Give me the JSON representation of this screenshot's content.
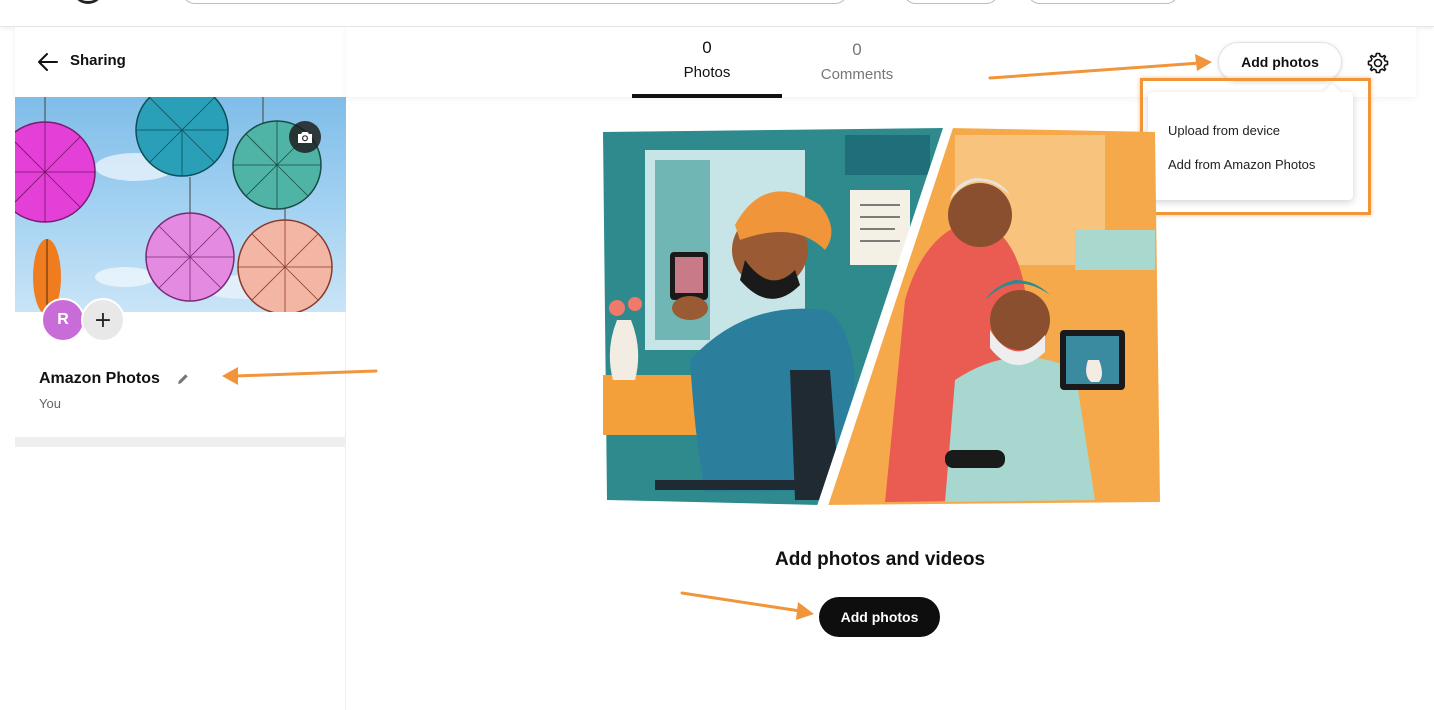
{
  "header": {
    "back_icon": "arrow-left-icon",
    "title": "Sharing"
  },
  "album": {
    "cover_icon": "camera-icon",
    "avatar_initial": "R",
    "avatar_color": "#c86dd7",
    "add_member_symbol": "+",
    "name": "Amazon Photos",
    "edit_icon": "pencil-icon",
    "owner": "You"
  },
  "tabs": [
    {
      "count": "0",
      "label": "Photos",
      "active": true
    },
    {
      "count": "0",
      "label": "Comments",
      "active": false
    }
  ],
  "toolbar": {
    "add_photos_label": "Add photos",
    "settings_icon": "gear-icon"
  },
  "dropdown": {
    "items": [
      "Upload from device",
      "Add from Amazon Photos"
    ]
  },
  "empty_state": {
    "title": "Add photos and videos",
    "button_label": "Add photos"
  },
  "colors": {
    "accent_annotation": "#f0953a",
    "primary_button": "#0e0e0e",
    "avatar": "#c86dd7"
  }
}
